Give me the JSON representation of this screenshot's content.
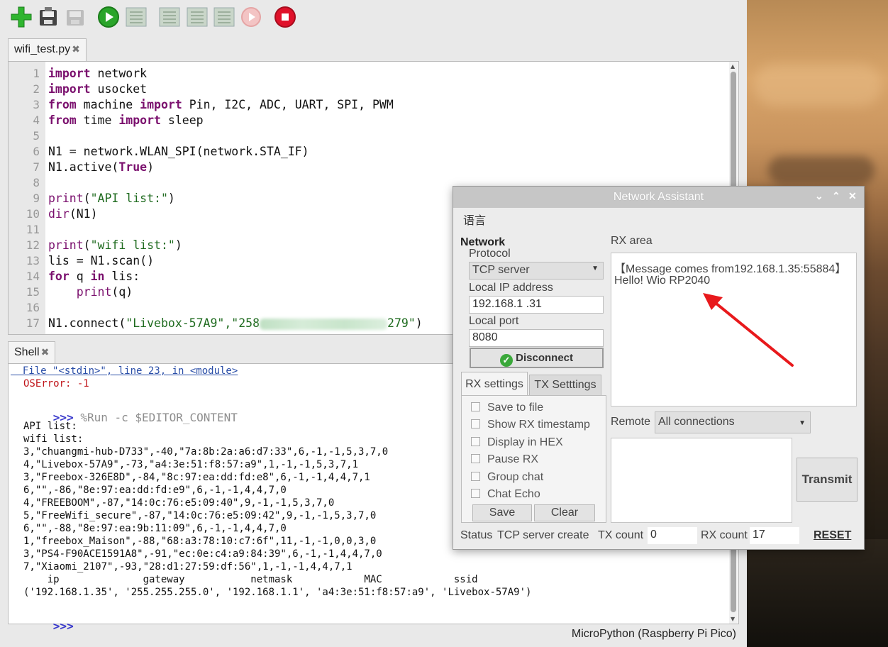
{
  "toolbar": {
    "buttons": [
      {
        "icon": "new-file-icon"
      },
      {
        "icon": "open-icon"
      },
      {
        "icon": "save-icon"
      },
      {
        "icon": "run-icon"
      },
      {
        "icon": "debug-icon"
      },
      {
        "icon": "step-over-icon"
      },
      {
        "icon": "step-into-icon"
      },
      {
        "icon": "step-out-icon"
      },
      {
        "icon": "resume-icon"
      },
      {
        "icon": "stop-icon"
      }
    ]
  },
  "editor": {
    "tab_label": "wifi_test.py",
    "line_numbers": [
      "1",
      "2",
      "3",
      "4",
      "5",
      "6",
      "7",
      "8",
      "9",
      "10",
      "11",
      "12",
      "13",
      "14",
      "15",
      "16",
      "17"
    ],
    "lines": [
      [
        {
          "t": "import",
          "c": "kw"
        },
        {
          "t": " network",
          "c": ""
        }
      ],
      [
        {
          "t": "import",
          "c": "kw"
        },
        {
          "t": " usocket",
          "c": ""
        }
      ],
      [
        {
          "t": "from",
          "c": "kw"
        },
        {
          "t": " machine ",
          "c": ""
        },
        {
          "t": "import",
          "c": "kw"
        },
        {
          "t": " Pin, I2C, ADC, UART, SPI, PWM",
          "c": ""
        }
      ],
      [
        {
          "t": "from",
          "c": "kw"
        },
        {
          "t": " time ",
          "c": ""
        },
        {
          "t": "import",
          "c": "kw"
        },
        {
          "t": " sleep",
          "c": ""
        }
      ],
      [],
      [
        {
          "t": "N1 = network.WLAN_SPI(network.STA_IF)",
          "c": ""
        }
      ],
      [
        {
          "t": "N1.active(",
          "c": ""
        },
        {
          "t": "True",
          "c": "kw"
        },
        {
          "t": ")",
          "c": ""
        }
      ],
      [],
      [
        {
          "t": "print",
          "c": "blt"
        },
        {
          "t": "(",
          "c": ""
        },
        {
          "t": "\"API list:\"",
          "c": "str"
        },
        {
          "t": ")",
          "c": ""
        }
      ],
      [
        {
          "t": "dir",
          "c": "blt"
        },
        {
          "t": "(N1)",
          "c": ""
        }
      ],
      [],
      [
        {
          "t": "print",
          "c": "blt"
        },
        {
          "t": "(",
          "c": ""
        },
        {
          "t": "\"wifi list:\"",
          "c": "str"
        },
        {
          "t": ")",
          "c": ""
        }
      ],
      [
        {
          "t": "lis = N1.scan()",
          "c": ""
        }
      ],
      [
        {
          "t": "for",
          "c": "kw"
        },
        {
          "t": " q ",
          "c": ""
        },
        {
          "t": "in",
          "c": "kw"
        },
        {
          "t": " lis:",
          "c": ""
        }
      ],
      [
        {
          "t": "    ",
          "c": ""
        },
        {
          "t": "print",
          "c": "blt"
        },
        {
          "t": "(q)",
          "c": ""
        }
      ],
      [],
      [
        {
          "t": "N1.connect(",
          "c": ""
        },
        {
          "t": "\"Livebox-57A9\",\"258",
          "c": "str"
        },
        {
          "t": "BLUR",
          "c": "blur"
        },
        {
          "t": "279\"",
          "c": "str"
        },
        {
          "t": ")",
          "c": ""
        }
      ]
    ]
  },
  "shell": {
    "tab_label": "Shell",
    "traceback_line": "  File \"<stdin>\", line 23, in <module>",
    "error_line": "OSError: -1",
    "prompt": ">>>",
    "run_command": " %Run -c $EDITOR_CONTENT",
    "output_lines": [
      "API list:",
      "wifi list:",
      "3,\"chuangmi-hub-D733\",-40,\"7a:8b:2a:a6:d7:33\",6,-1,-1,5,3,7,0",
      "4,\"Livebox-57A9\",-73,\"a4:3e:51:f8:57:a9\",1,-1,-1,5,3,7,1",
      "3,\"Freebox-326E8D\",-84,\"8c:97:ea:dd:fd:e8\",6,-1,-1,4,4,7,1",
      "6,\"\",-86,\"8e:97:ea:dd:fd:e9\",6,-1,-1,4,4,7,0",
      "4,\"FREEBOOM\",-87,\"14:0c:76:e5:09:40\",9,-1,-1,5,3,7,0",
      "5,\"FreeWifi_secure\",-87,\"14:0c:76:e5:09:42\",9,-1,-1,5,3,7,0",
      "6,\"\",-88,\"8e:97:ea:9b:11:09\",6,-1,-1,4,4,7,0",
      "1,\"freebox_Maison\",-88,\"68:a3:78:10:c7:6f\",11,-1,-1,0,0,3,0",
      "3,\"PS4-F90ACE1591A8\",-91,\"ec:0e:c4:a9:84:39\",6,-1,-1,4,4,7,0",
      "7,\"Xiaomi_2107\",-93,\"28:d1:27:59:df:56\",1,-1,-1,4,4,7,1",
      "    ip              gateway           netmask            MAC            ssid",
      "('192.168.1.35', '255.255.255.0', '192.168.1.1', 'a4:3e:51:f8:57:a9', 'Livebox-57A9')"
    ],
    "final_prompt": ">>>"
  },
  "statusbar": {
    "interpreter": "MicroPython (Raspberry Pi Pico)"
  },
  "network_assistant": {
    "title": "Network Assistant",
    "menu_language": "语言",
    "network_heading": "Network",
    "protocol_label": "Protocol",
    "protocol_value": "TCP server",
    "local_ip_label": "Local IP address",
    "local_ip_value": "192.168.1  .31",
    "local_port_label": "Local port",
    "local_port_value": "8080",
    "disconnect_label": "Disconnect",
    "tabs": [
      "RX settings",
      "TX Setttings"
    ],
    "rx_options": [
      "Save to file",
      "Show RX timestamp",
      "Display in HEX",
      "Pause RX",
      "Group chat",
      "Chat Echo"
    ],
    "save_label": "Save",
    "clear_label": "Clear",
    "rx_area_label": "RX area",
    "rx_message_header": "【Message comes from192.168.1.35:55884】",
    "rx_message_body": "Hello! Wio RP2040",
    "remote_label": "Remote",
    "remote_value": "All connections",
    "transmit_label": "Transmit",
    "status_label": "Status",
    "status_value": "TCP server create",
    "tx_count_label": "TX count",
    "tx_count_value": "0",
    "rx_count_label": "RX count",
    "rx_count_value": "17",
    "reset_label": "RESET",
    "colors": {
      "annotation_arrow": "#e8191c",
      "connected_icon": "#3aa83a"
    }
  }
}
